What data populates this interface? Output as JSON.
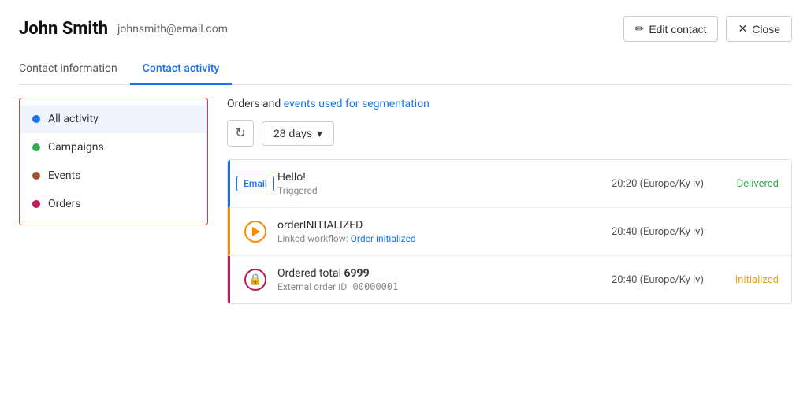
{
  "header": {
    "name": "John Smith",
    "email": "johnsmith@email.com",
    "edit_button": "Edit contact",
    "close_button": "Close"
  },
  "tabs": [
    {
      "id": "contact-info",
      "label": "Contact information",
      "active": false
    },
    {
      "id": "contact-activity",
      "label": "Contact activity",
      "active": true
    }
  ],
  "sidebar": {
    "items": [
      {
        "id": "all",
        "label": "All activity",
        "dot": "blue",
        "active": true
      },
      {
        "id": "campaigns",
        "label": "Campaigns",
        "dot": "green",
        "active": false
      },
      {
        "id": "events",
        "label": "Events",
        "dot": "brown",
        "active": false
      },
      {
        "id": "orders",
        "label": "Orders",
        "dot": "pink",
        "active": false
      }
    ]
  },
  "filter": {
    "info_text_before": "Orders",
    "info_text_link": "events used for segmentation",
    "days_label": "28 days"
  },
  "activity": {
    "rows": [
      {
        "id": "email-row",
        "type": "email",
        "tag": "Email",
        "title": "Hello!",
        "subtitle": "Triggered",
        "time": "20:20 (Europe/Ky iv)",
        "status": "Delivered",
        "status_type": "delivered"
      },
      {
        "id": "order-init-row",
        "type": "order-init",
        "title": "orderINITIALIZED",
        "subtitle_prefix": "Linked workflow: ",
        "subtitle_link": "Order initialized",
        "time": "20:40 (Europe/Ky iv)",
        "status": "",
        "status_type": ""
      },
      {
        "id": "order-row",
        "type": "order",
        "title_prefix": "Ordered total",
        "title_bold": " 6999",
        "subtitle_prefix": "External order ID",
        "subtitle_mono": "  00000001",
        "time": "20:40 (Europe/Ky iv)",
        "status": "Initialized",
        "status_type": "initialized"
      }
    ]
  }
}
